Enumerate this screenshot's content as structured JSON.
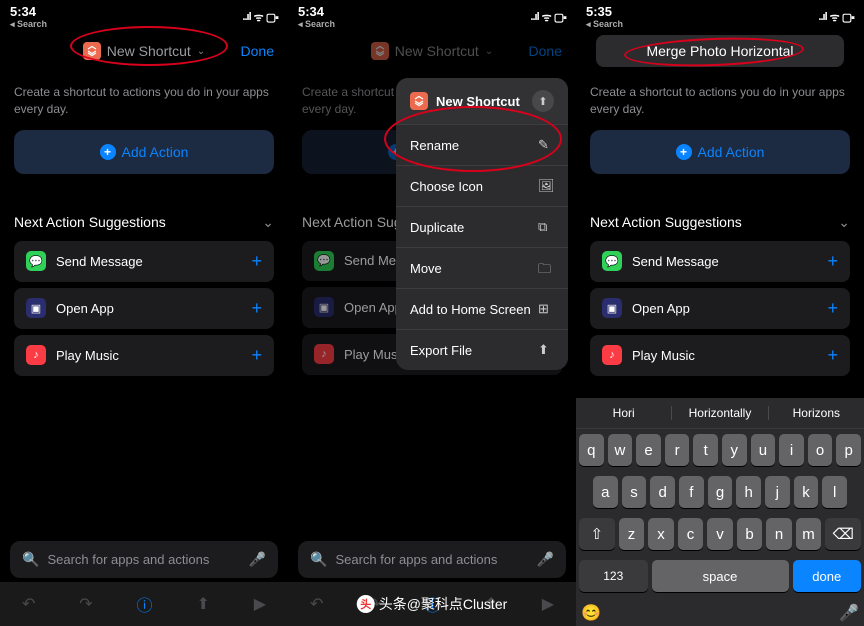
{
  "status": {
    "time1": "5:34",
    "time2": "5:34",
    "time3": "5:35",
    "back": "Search",
    "signal": "..ıl",
    "wifi": "ᯤ",
    "battery": "▢▪"
  },
  "screen1": {
    "title": "New Shortcut",
    "done": "Done",
    "subtitle": "Create a shortcut to actions you do in your apps every day.",
    "add_action": "Add Action",
    "section": "Next Action Suggestions",
    "suggestions": [
      {
        "label": "Send Message",
        "icon": "app-msg"
      },
      {
        "label": "Open App",
        "icon": "app-open"
      },
      {
        "label": "Play Music",
        "icon": "app-music"
      }
    ],
    "search": "Search for apps and actions"
  },
  "screen2": {
    "menu_title": "New Shortcut",
    "items": [
      {
        "label": "Rename",
        "icon": "pencil"
      },
      {
        "label": "Choose Icon",
        "icon": "image"
      },
      {
        "label": "Duplicate",
        "icon": "copy"
      },
      {
        "label": "Move",
        "icon": "folder"
      },
      {
        "label": "Add to Home Screen",
        "icon": "plus-square"
      },
      {
        "label": "Export File",
        "icon": "share"
      }
    ],
    "suggestions_visible": [
      "Send Messa",
      "Open App",
      "Play Music"
    ]
  },
  "screen3": {
    "input_value": "Merge Photo Horizontal",
    "subtitle": "Create a shortcut to actions you do in your apps every day.",
    "add_action": "Add Action",
    "section": "Next Action Suggestions",
    "suggestions": [
      {
        "label": "Send Message",
        "icon": "app-msg"
      },
      {
        "label": "Open App",
        "icon": "app-open"
      },
      {
        "label": "Play Music",
        "icon": "app-music"
      }
    ],
    "kb_suggest": [
      "Hori",
      "Horizontally",
      "Horizons"
    ],
    "rows": {
      "r1": [
        "q",
        "w",
        "e",
        "r",
        "t",
        "y",
        "u",
        "i",
        "o",
        "p"
      ],
      "r2": [
        "a",
        "s",
        "d",
        "f",
        "g",
        "h",
        "j",
        "k",
        "l"
      ],
      "r3": [
        "z",
        "x",
        "c",
        "v",
        "b",
        "n",
        "m"
      ]
    },
    "shift": "⇧",
    "backspace": "⌫",
    "num": "123",
    "space": "space",
    "done": "done"
  },
  "watermark": "头条@聚科点Cluster"
}
